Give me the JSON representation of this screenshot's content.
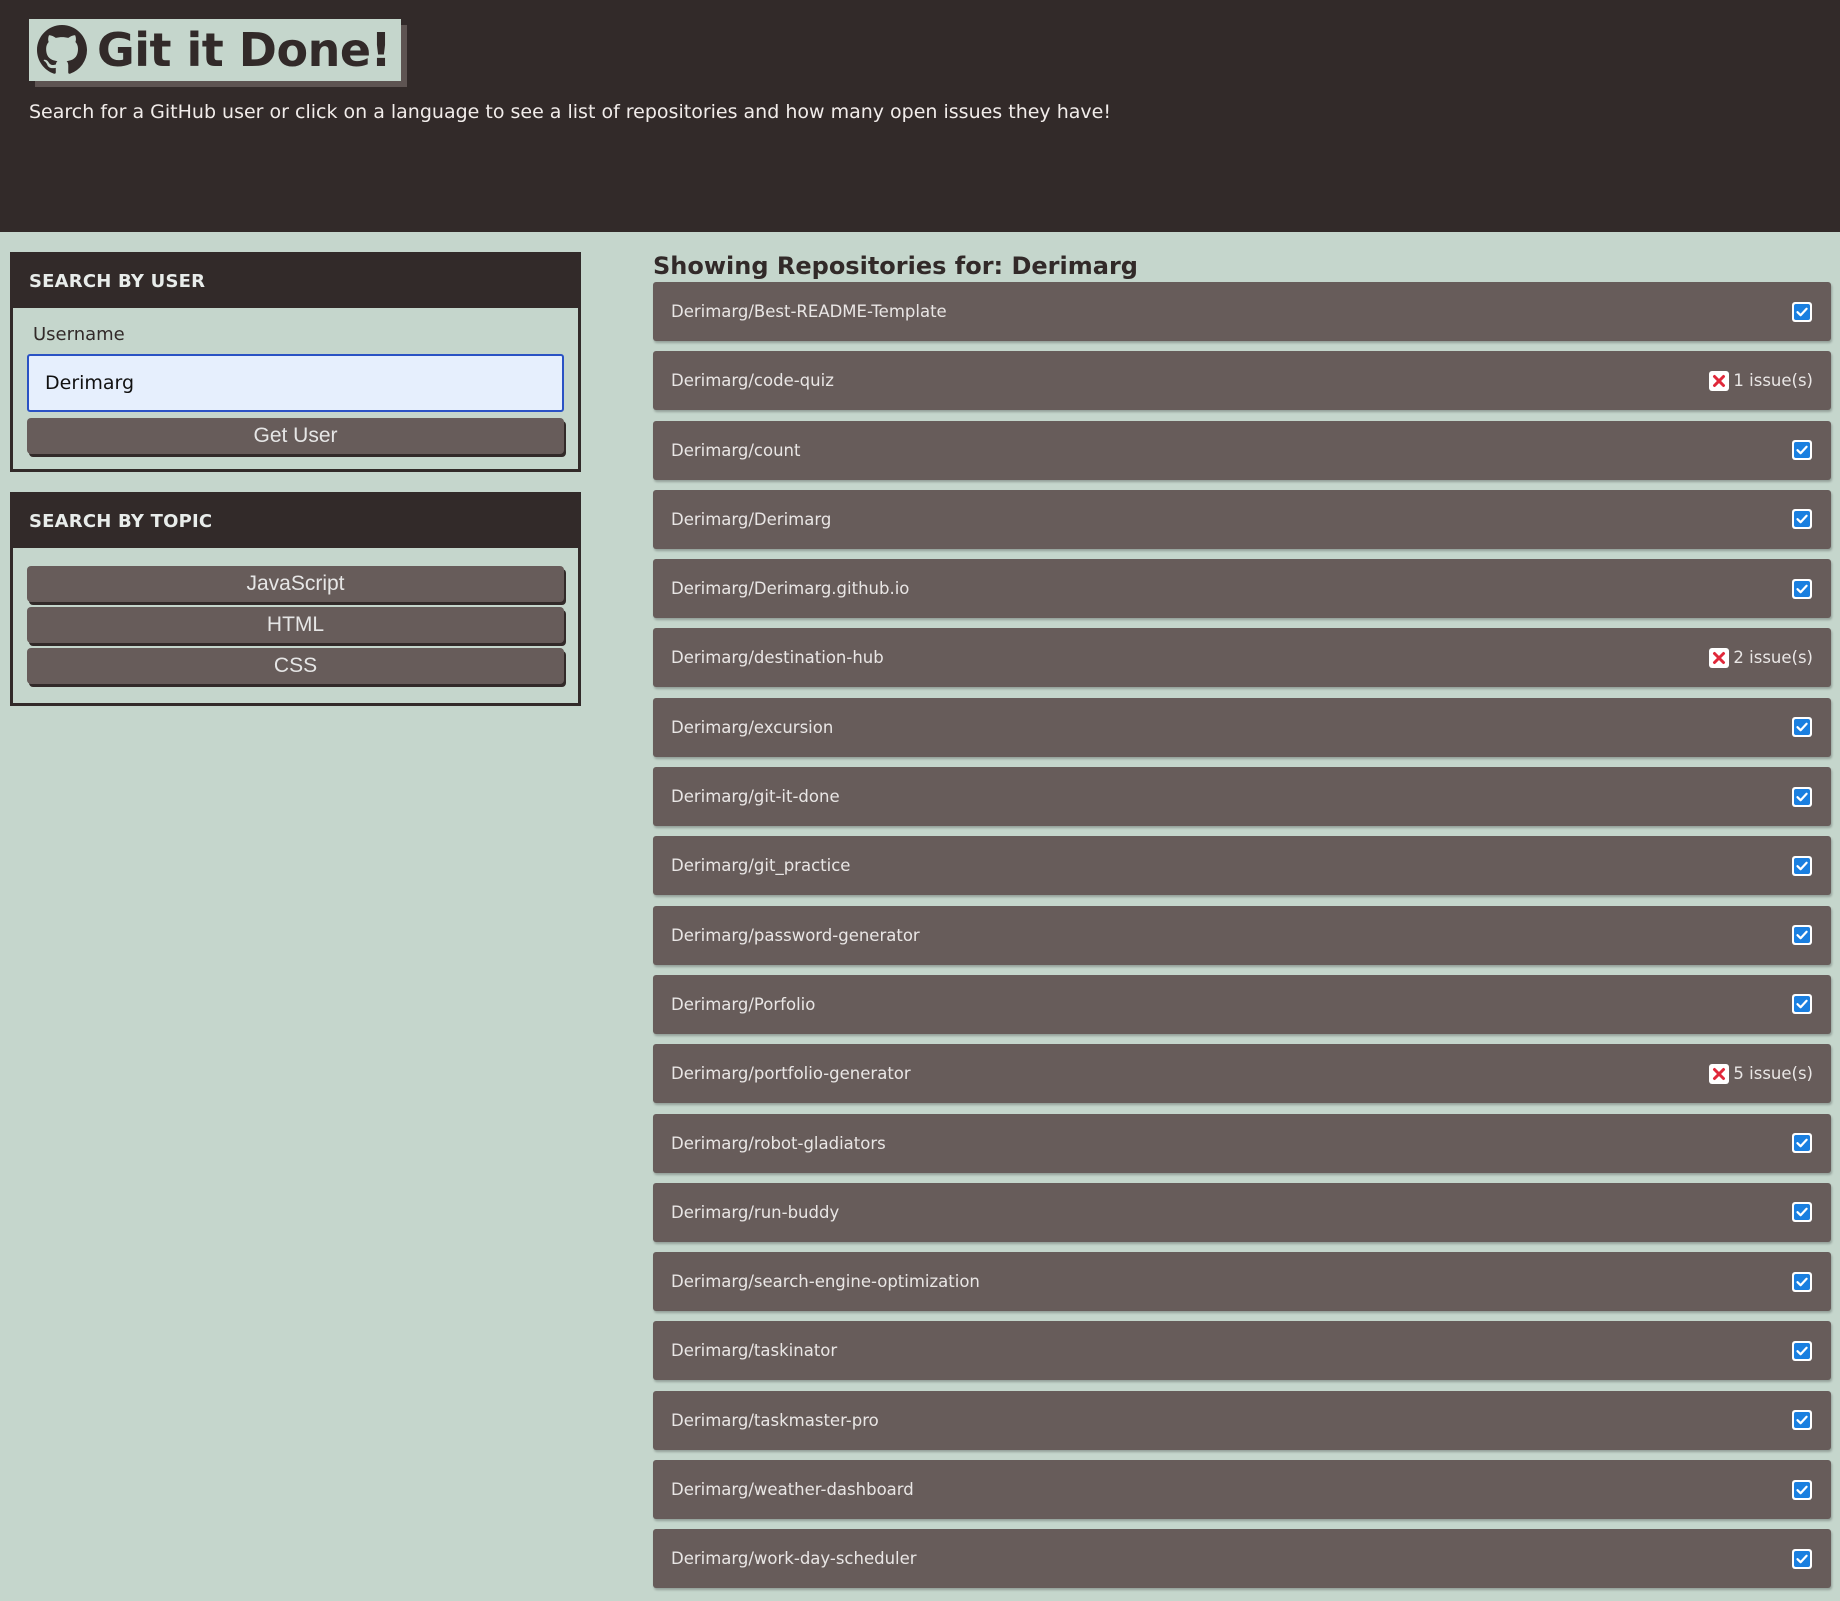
{
  "header": {
    "title": "Git it Done!",
    "logo_icon": "github-icon",
    "subtitle": "Search for a GitHub user or click on a language to see a list of repositories and how many open issues they have!"
  },
  "user_search": {
    "heading": "SEARCH BY USER",
    "label": "Username",
    "value": "Derimarg",
    "button_label": "Get User"
  },
  "topic_search": {
    "heading": "SEARCH BY TOPIC",
    "topics": [
      "JavaScript",
      "HTML",
      "CSS"
    ]
  },
  "results": {
    "title": "Showing Repositories for: Derimarg",
    "repos": [
      {
        "name": "Derimarg/Best-README-Template",
        "status": "ok",
        "issues": ""
      },
      {
        "name": "Derimarg/code-quiz",
        "status": "issues",
        "issues": "1 issue(s)"
      },
      {
        "name": "Derimarg/count",
        "status": "ok",
        "issues": ""
      },
      {
        "name": "Derimarg/Derimarg",
        "status": "ok",
        "issues": ""
      },
      {
        "name": "Derimarg/Derimarg.github.io",
        "status": "ok",
        "issues": ""
      },
      {
        "name": "Derimarg/destination-hub",
        "status": "issues",
        "issues": "2 issue(s)"
      },
      {
        "name": "Derimarg/excursion",
        "status": "ok",
        "issues": ""
      },
      {
        "name": "Derimarg/git-it-done",
        "status": "ok",
        "issues": ""
      },
      {
        "name": "Derimarg/git_practice",
        "status": "ok",
        "issues": ""
      },
      {
        "name": "Derimarg/password-generator",
        "status": "ok",
        "issues": ""
      },
      {
        "name": "Derimarg/Porfolio",
        "status": "ok",
        "issues": ""
      },
      {
        "name": "Derimarg/portfolio-generator",
        "status": "issues",
        "issues": "5 issue(s)"
      },
      {
        "name": "Derimarg/robot-gladiators",
        "status": "ok",
        "issues": ""
      },
      {
        "name": "Derimarg/run-buddy",
        "status": "ok",
        "issues": ""
      },
      {
        "name": "Derimarg/search-engine-optimization",
        "status": "ok",
        "issues": ""
      },
      {
        "name": "Derimarg/taskinator",
        "status": "ok",
        "issues": ""
      },
      {
        "name": "Derimarg/taskmaster-pro",
        "status": "ok",
        "issues": ""
      },
      {
        "name": "Derimarg/weather-dashboard",
        "status": "ok",
        "issues": ""
      },
      {
        "name": "Derimarg/work-day-scheduler",
        "status": "ok",
        "issues": ""
      }
    ]
  },
  "colors": {
    "header_bg": "#322a29",
    "page_bg": "#c5d6cc",
    "card_bg": "#675c5a",
    "check": "#1a7fe0",
    "error": "#e0283a"
  },
  "icons": {
    "ok": "checkbox-check-icon",
    "issues": "red-x-icon"
  }
}
